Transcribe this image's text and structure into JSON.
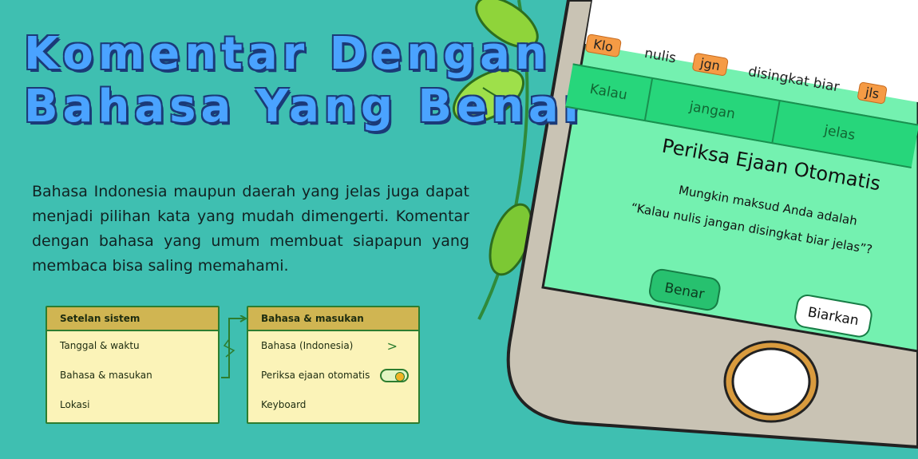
{
  "title": {
    "line1": "Komentar Dengan",
    "line2": "Bahasa Yang Benar"
  },
  "description": "Bahasa Indonesia maupun daerah yang jelas juga dapat menjadi pilihan kata yang mudah dimengerti. Komentar dengan bahasa yang umum membuat siapapun yang membaca bisa saling memahami.",
  "settings_panel": {
    "header": "Setelan sistem",
    "items": [
      "Tanggal & waktu",
      "Bahasa & masukan",
      "Lokasi"
    ]
  },
  "language_panel": {
    "header": "Bahasa & masukan",
    "items": [
      "Bahasa (Indonesia)",
      "Periksa ejaan otomatis",
      "Keyboard"
    ],
    "spellcheck_enabled": true
  },
  "phone": {
    "typed_words": [
      {
        "text": "Klo",
        "highlighted": true
      },
      {
        "text": "nulis",
        "highlighted": false
      },
      {
        "text": "jgn",
        "highlighted": true
      },
      {
        "text": "disingkat biar",
        "highlighted": false
      },
      {
        "text": "jls",
        "highlighted": true
      }
    ],
    "suggestions": [
      "Kalau",
      "jangan",
      "jelas"
    ],
    "dialog": {
      "title": "Periksa Ejaan Otomatis",
      "line1": "Mungkin maksud Anda adalah",
      "line2": "“Kalau nulis jangan disingkat biar jelas”?",
      "accept_label": "Benar",
      "dismiss_label": "Biarkan"
    }
  },
  "colors": {
    "background": "#3fbfb1",
    "title_fill": "#4aa3ff",
    "title_outline": "#1b3a78",
    "panel_bg": "#fbf3b8",
    "panel_header": "#d0b552",
    "screen_bg": "#74f1b0",
    "suggestion_bar": "#27d67b",
    "highlight_tag": "#f59b45"
  }
}
